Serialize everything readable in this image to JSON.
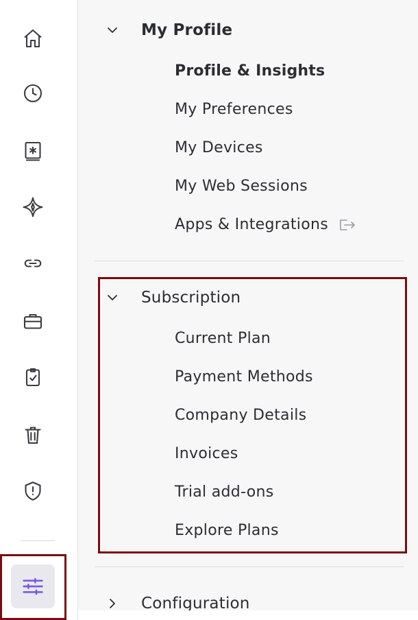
{
  "colors": {
    "accent": "#7b5cd6",
    "highlight": "#7a0a10",
    "text": "#2b2d33",
    "icon": "#3a3c42"
  },
  "rail": {
    "items": [
      {
        "icon": "home-icon"
      },
      {
        "icon": "clock-icon"
      },
      {
        "icon": "vault-icon"
      },
      {
        "icon": "sparkle-icon"
      },
      {
        "icon": "link-icon"
      },
      {
        "icon": "briefcase-icon"
      },
      {
        "icon": "clipboard-check-icon"
      },
      {
        "icon": "trash-icon"
      },
      {
        "icon": "shield-alert-icon"
      }
    ],
    "active_icon": "sliders-icon"
  },
  "menu": {
    "profile": {
      "title": "My Profile",
      "items": [
        {
          "label": "Profile & Insights"
        },
        {
          "label": "My Preferences"
        },
        {
          "label": "My Devices"
        },
        {
          "label": "My Web Sessions"
        },
        {
          "label": "Apps & Integrations",
          "icon": "external-open-icon"
        }
      ]
    },
    "subscription": {
      "title": "Subscription",
      "items": [
        {
          "label": "Current Plan"
        },
        {
          "label": "Payment Methods"
        },
        {
          "label": "Company Details"
        },
        {
          "label": "Invoices"
        },
        {
          "label": "Trial add-ons"
        },
        {
          "label": "Explore Plans"
        }
      ]
    },
    "configuration": {
      "title": "Configuration"
    }
  }
}
